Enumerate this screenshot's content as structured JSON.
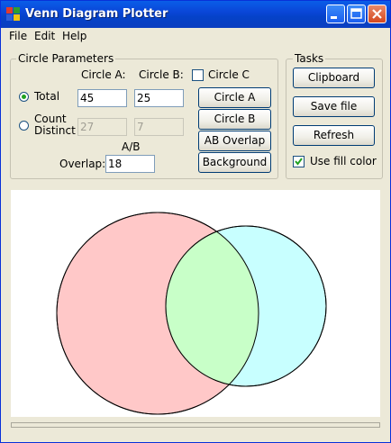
{
  "window": {
    "title": "Venn Diagram Plotter"
  },
  "menu": [
    "File",
    "Edit",
    "Help"
  ],
  "circle_parameters": {
    "group_title": "Circle Parameters",
    "circle_a_header": "Circle A:",
    "circle_b_header": "Circle B:",
    "circle_c_label": "Circle C",
    "circle_c_checked": false,
    "total_label": "Total",
    "total_selected": true,
    "count_distinct_label_1": "Count",
    "count_distinct_label_2": "Distinct",
    "total_a": "45",
    "total_b": "25",
    "distinct_a": "27",
    "distinct_b": "7",
    "overlap_header": "A/B",
    "overlap_label": "Overlap:",
    "overlap_value": "18",
    "btn_circle_a": "Circle A",
    "btn_circle_b": "Circle B",
    "btn_ab_overlap": "AB Overlap",
    "btn_background": "Background"
  },
  "tasks": {
    "group_title": "Tasks",
    "btn_clipboard": "Clipboard",
    "btn_save_file": "Save file",
    "btn_refresh": "Refresh",
    "use_fill_color_label": "Use fill color",
    "use_fill_color_checked": true
  },
  "diagram_colors": {
    "circle_a_fill": "#ffc8c8",
    "circle_b_fill": "#c8ffff",
    "overlap_fill": "#c8ffc8",
    "outline": "#000000"
  },
  "titlebar_colors": {
    "gradient_top": "#0a5ee8",
    "gradient_bottom": "#0a3ec0"
  }
}
